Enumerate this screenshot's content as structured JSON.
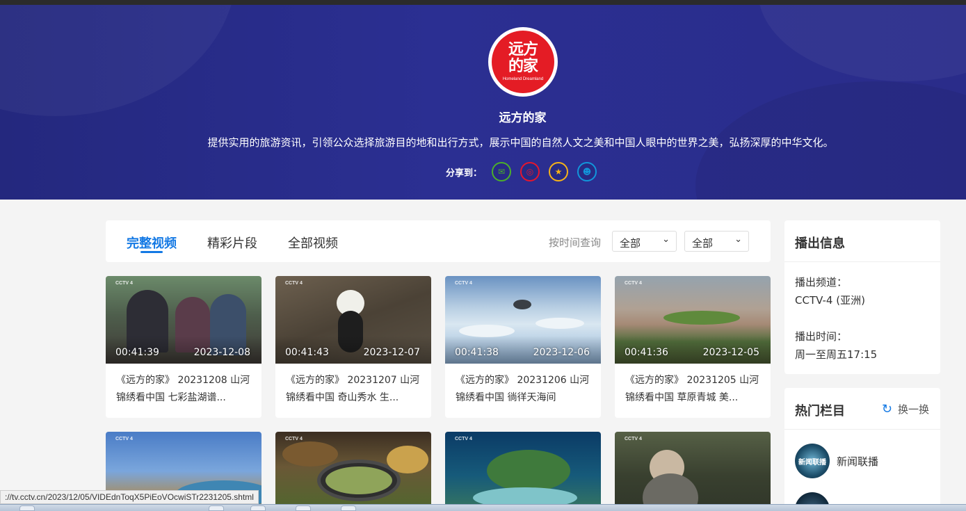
{
  "header": {
    "logo_line1": "远方",
    "logo_line2": "的家",
    "logo_subtitle": "Homeland Dreamland",
    "title": "远方的家",
    "description": "提供实用的旅游资讯，引领公众选择旅游目的地和出行方式，展示中国的自然人文之美和中国人眼中的世界之美，弘扬深厚的中华文化。",
    "share_label": "分享到：",
    "share_buttons": [
      {
        "name": "wechat-icon",
        "glyph": "✉"
      },
      {
        "name": "weibo-icon",
        "glyph": "◎"
      },
      {
        "name": "qzone-icon",
        "glyph": "★"
      },
      {
        "name": "qq-icon",
        "glyph": "☻"
      }
    ]
  },
  "tabs": {
    "items": [
      "完整视频",
      "精彩片段",
      "全部视频"
    ],
    "active": "完整视频",
    "filter_label": "按时间查询",
    "select1": "全部",
    "select2": "全部"
  },
  "videos": [
    {
      "duration": "00:41:39",
      "date": "2023-12-08",
      "title": "《远方的家》 20231208 山河锦绣看中国 七彩盐湖谱..."
    },
    {
      "duration": "00:41:43",
      "date": "2023-12-07",
      "title": "《远方的家》 20231207 山河锦绣看中国 奇山秀水 生..."
    },
    {
      "duration": "00:41:38",
      "date": "2023-12-06",
      "title": "《远方的家》 20231206 山河锦绣看中国 徜徉天海间"
    },
    {
      "duration": "00:41:36",
      "date": "2023-12-05",
      "title": "《远方的家》 20231205 山河锦绣看中国 草原青城 美..."
    },
    {
      "duration": "",
      "date": "",
      "title": ""
    },
    {
      "duration": "",
      "date": "",
      "title": ""
    },
    {
      "duration": "",
      "date": "",
      "title": ""
    },
    {
      "duration": "",
      "date": "",
      "title": ""
    }
  ],
  "broadcast": {
    "title": "播出信息",
    "channel_label": "播出频道：",
    "channel_value": "CCTV-4 (亚洲)",
    "time_label": "播出时间：",
    "time_value": "周一至周五17:15"
  },
  "hot": {
    "title": "热门栏目",
    "refresh_label": "换一换",
    "items": [
      {
        "avatar_text": "新闻联播",
        "name": "新闻联播"
      }
    ]
  },
  "status_url": "://tv.cctv.cn/2023/12/05/VIDEdnToqX5PiEoVOcwiSTr2231205.shtml",
  "thumb_logo": "CCTV 4"
}
